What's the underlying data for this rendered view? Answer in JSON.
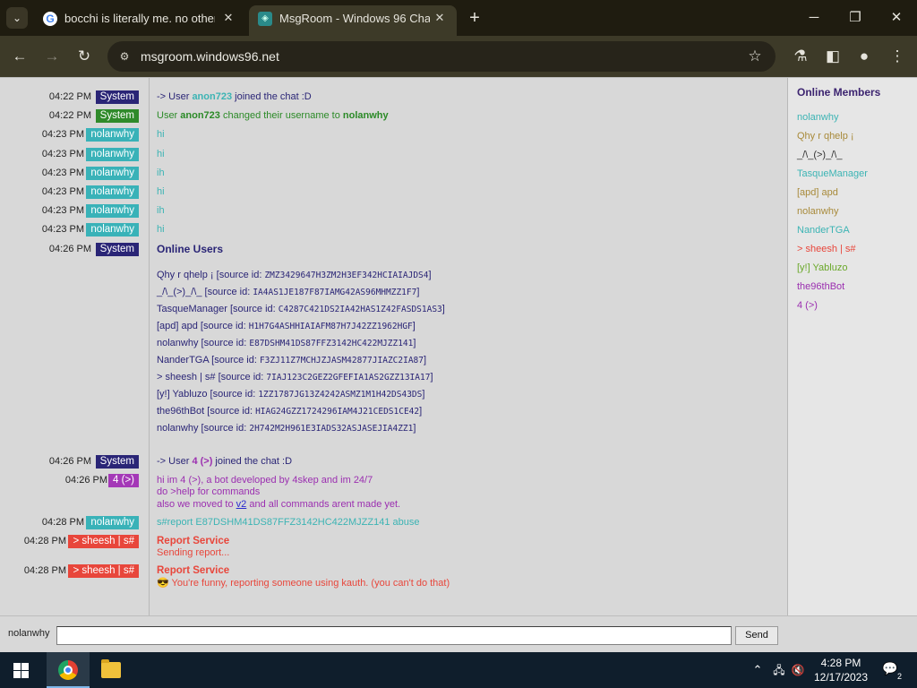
{
  "browser": {
    "tabs": [
      {
        "title": "bocchi is literally me. no other",
        "favicon": "google-g-icon",
        "close": "✕"
      },
      {
        "title": "MsgRoom - Windows 96 Chat",
        "favicon": "windows96-icon",
        "close": "✕"
      }
    ],
    "url": "msgroom.windows96.net"
  },
  "chat": {
    "messages": [
      {
        "time": "04:22 PM",
        "user": "System",
        "kind": "system"
      },
      {
        "time": "04:22 PM",
        "user": "System",
        "kind": "system-green"
      },
      {
        "time": "04:23 PM",
        "user": "nolanwhy",
        "kind": "nolan",
        "text": "hi"
      },
      {
        "time": "04:23 PM",
        "user": "nolanwhy",
        "kind": "nolan",
        "text": "hi"
      },
      {
        "time": "04:23 PM",
        "user": "nolanwhy",
        "kind": "nolan",
        "text": "ih"
      },
      {
        "time": "04:23 PM",
        "user": "nolanwhy",
        "kind": "nolan",
        "text": "hi"
      },
      {
        "time": "04:23 PM",
        "user": "nolanwhy",
        "kind": "nolan",
        "text": "ih"
      },
      {
        "time": "04:23 PM",
        "user": "nolanwhy",
        "kind": "nolan",
        "text": "hi"
      },
      {
        "time": "04:26 PM",
        "user": "System",
        "kind": "system"
      },
      {
        "time": "04:26 PM",
        "user": "System",
        "kind": "system"
      },
      {
        "time": "04:26 PM",
        "user": "4 (>)",
        "kind": "four"
      },
      {
        "time": "04:28 PM",
        "user": "nolanwhy",
        "kind": "nolan"
      },
      {
        "time": "04:28 PM",
        "user": "> sheesh | s#",
        "kind": "sheesh"
      },
      {
        "time": "04:28 PM",
        "user": "> sheesh | s#",
        "kind": "sheesh"
      }
    ],
    "join1": {
      "prefix": "-> User ",
      "name": "anon723",
      "suffix": " joined the chat :D"
    },
    "rename": {
      "prefix": "User ",
      "old": "anon723",
      "middle": " changed their username to ",
      "new": "nolanwhy"
    },
    "online_users": {
      "title": "Online Users",
      "source_label": " [source id: ",
      "entries": [
        {
          "name": "Qhy r qhelp ¡",
          "id": "ZMZ3429647H3ZM2H3EF342HCIAIAJDS4"
        },
        {
          "name": "_/\\_(>)_/\\_",
          "id": "IA4AS1JE187F87IAMG42AS96MHMZZ1F7"
        },
        {
          "name": "TasqueManager",
          "id": "C4287C421DS2IA42HAS1Z42FASDS1AS3"
        },
        {
          "name": "[apd] apd",
          "id": "H1H7G4ASHHIAIAFM87H7J42ZZ1962HGF"
        },
        {
          "name": "nolanwhy",
          "id": "E87DSHM41DS87FFZ3142HC422MJZZ141"
        },
        {
          "name": "NanderTGA",
          "id": "F3ZJ11Z7MCHJZJASM42877JIAZC2IA87"
        },
        {
          "name": "> sheesh | s#",
          "id": "7IAJ123C2GEZ2GFEFIA1AS2GZZ13IA17"
        },
        {
          "name": "[y!] Yabluzo",
          "id": "1ZZ1787JG13Z4242ASMZ1M1H42DS43DS"
        },
        {
          "name": "the96thBot",
          "id": "HIAG24GZZ1724296IAM4J21CEDS1CE42"
        },
        {
          "name": "nolanwhy",
          "id": "2H742M2H961E3IADS32ASJASEJIA4ZZ1"
        }
      ]
    },
    "join2": {
      "prefix": "-> User ",
      "name": "4 (>)",
      "suffix": " joined the chat :D"
    },
    "bot_intro": {
      "line1": "hi im 4 (>), a bot developed by 4skep and im 24/7",
      "line2": "do >help for commands",
      "line3_pre": "also we moved to ",
      "line3_link": "v2",
      "line3_post": " and all commands arent made yet."
    },
    "report_cmd": "s#report E87DSHM41DS87FFZ3142HC422MJZZ141 abuse",
    "report1": {
      "title": "Report Service",
      "text": "Sending report..."
    },
    "report2": {
      "title": "Report Service",
      "emoji": "😎",
      "text": " You're funny, reporting someone using kauth. (you can't do that)"
    }
  },
  "members": {
    "title": "Online Members",
    "list": [
      {
        "name": "nolanwhy",
        "color": "#3cb4b4"
      },
      {
        "name": "Qhy r qhelp ¡",
        "color": "#a88a3a"
      },
      {
        "name": "_/\\_(>)_/\\_",
        "color": "#333333"
      },
      {
        "name": "TasqueManager",
        "color": "#3cb4b4"
      },
      {
        "name": "[apd] apd",
        "color": "#a88a3a"
      },
      {
        "name": "nolanwhy",
        "color": "#a88a3a"
      },
      {
        "name": "NanderTGA",
        "color": "#3cb4b4"
      },
      {
        "name": "> sheesh | s#",
        "color": "#e8463b"
      },
      {
        "name": "[y!] Yabluzo",
        "color": "#6aa82a"
      },
      {
        "name": "the96thBot",
        "color": "#9b2fb0"
      },
      {
        "name": "4 (>)",
        "color": "#9b2fb0"
      }
    ]
  },
  "input": {
    "nickname": "nolanwhy",
    "value": "",
    "send_label": "Send"
  },
  "taskbar": {
    "time": "4:28 PM",
    "date": "12/17/2023",
    "notification_count": "2"
  }
}
